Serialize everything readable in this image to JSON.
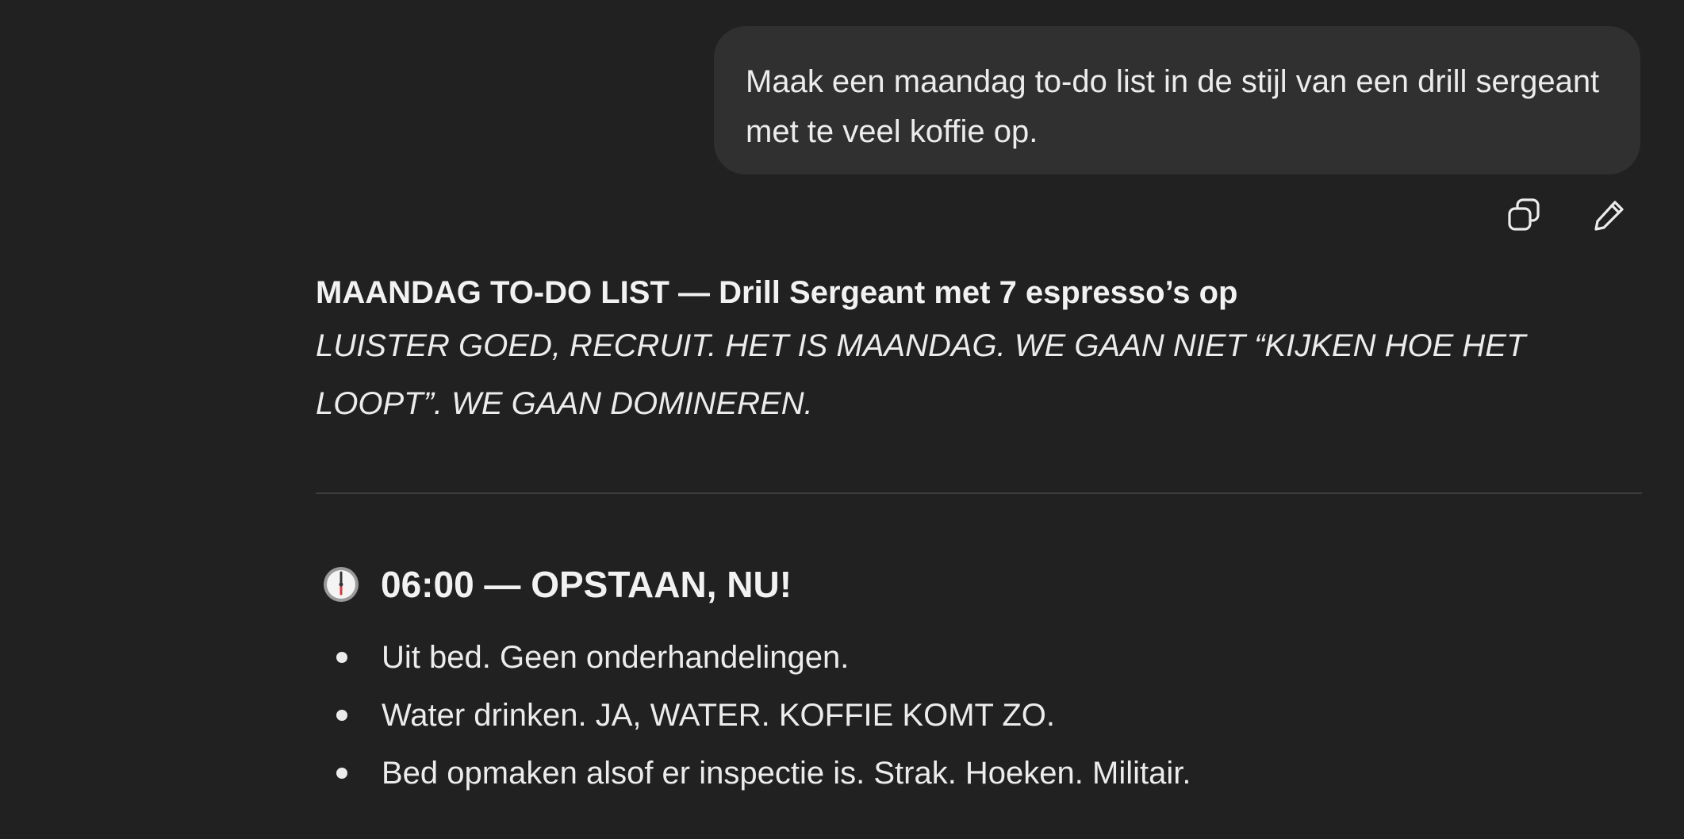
{
  "user_message": {
    "text": "Maak een maandag to-do list in de stijl van een drill sergeant met te veel koffie op."
  },
  "message_actions": {
    "copy_icon": "copy-icon",
    "edit_icon": "pencil-icon"
  },
  "response": {
    "title": "MAANDAG TO-DO LIST — Drill Sergeant met 7 espresso’s op",
    "intro": "LUISTER GOED, RECRUIT. HET IS MAANDAG. WE GAAN NIET “KIJKEN HOE HET LOOPT”. WE GAAN DOMINEREN.",
    "sections": [
      {
        "icon": "clock-icon",
        "heading": "06:00 — OPSTAAN, NU!",
        "items": [
          "Uit bed. Geen onderhandelingen.",
          "Water drinken. JA, WATER. KOFFIE KOMT ZO.",
          "Bed opmaken alsof er inspectie is. Strak. Hoeken. Militair."
        ]
      }
    ]
  },
  "colors": {
    "background": "#212121",
    "bubble": "#303030",
    "text": "#ececec",
    "divider": "#3d3d3d"
  }
}
